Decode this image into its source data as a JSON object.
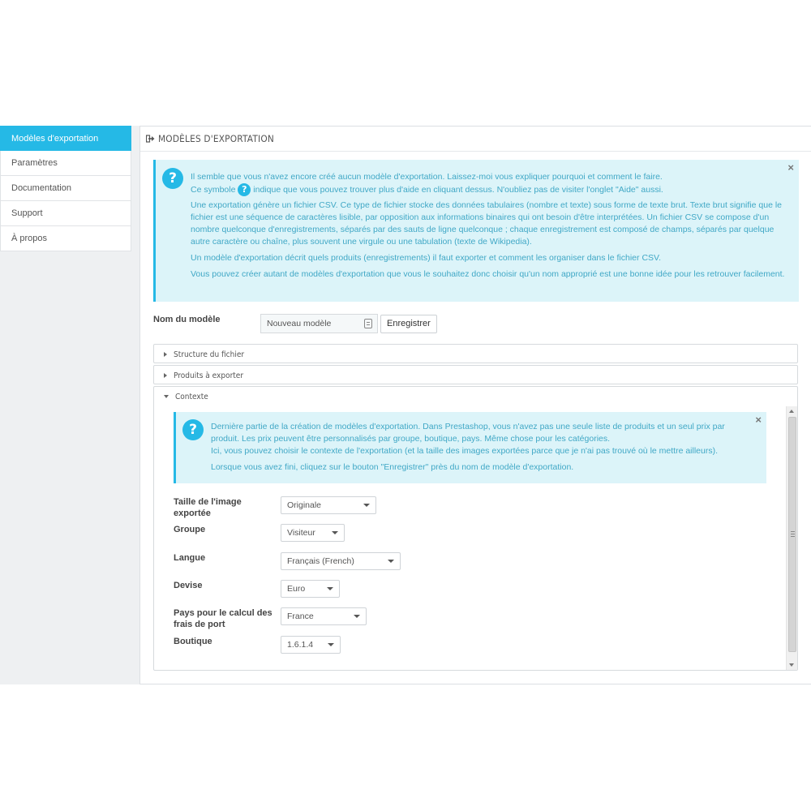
{
  "sidebar": {
    "items": [
      {
        "label": "Modèles d'exportation",
        "active": true
      },
      {
        "label": "Paramètres"
      },
      {
        "label": "Documentation"
      },
      {
        "label": "Support"
      },
      {
        "label": "À propos"
      }
    ]
  },
  "panel": {
    "icon": "sign-out-icon",
    "title": "MODÈLES D'EXPORTATION"
  },
  "intro_alert": {
    "line1": "Il semble que vous n'avez encore créé aucun modèle d'exportation. Laissez-moi vous expliquer pourquoi et comment le faire.",
    "line2_before": "Ce symbole",
    "help_symbol": "?",
    "line2_after": "indique que vous pouvez trouver plus d'aide en cliquant dessus. N'oubliez pas de visiter l'onglet \"Aide\" aussi.",
    "para1": "Une exportation génère un fichier CSV. Ce type de fichier stocke des données tabulaires (nombre et texte) sous forme de texte brut. Texte brut signifie que le fichier est une séquence de caractères lisible, par opposition aux informations binaires qui ont besoin d'être interprétées. Un fichier CSV se compose d'un nombre quelconque d'enregistrements, séparés par des sauts de ligne quelconque ; chaque enregistrement est composé de champs, séparés par quelque autre caractère ou chaîne, plus souvent une virgule ou une tabulation (texte de Wikipedia).",
    "para2": "Un modèle d'exportation décrit quels produits (enregistrements) il faut exporter et comment les organiser dans le fichier CSV.",
    "para3": "Vous pouvez créer autant de modèles d'exportation que vous le souhaitez donc choisir qu'un nom approprié est une bonne idée pour les retrouver facilement.",
    "close": "×"
  },
  "name_row": {
    "label": "Nom du modèle",
    "placeholder": "Nouveau modèle",
    "save_label": "Enregistrer"
  },
  "accordion": [
    {
      "label": "Structure du fichier",
      "expanded": false
    },
    {
      "label": "Produits à exporter",
      "expanded": false
    },
    {
      "label": "Contexte",
      "expanded": true
    }
  ],
  "context_alert": {
    "line1": "Dernière partie de la création de modèles d'exportation. Dans Prestashop, vous n'avez pas une seule liste de produits et un seul prix par produit. Les prix peuvent être personnalisés par groupe, boutique, pays. Même chose pour les catégories.",
    "line2": "Ici, vous pouvez choisir le contexte de l'exportation (et la taille des images exportées parce que je n'ai pas trouvé où le mettre ailleurs).",
    "line3": "Lorsque vous avez fini, cliquez sur le bouton \"Enregistrer\" près du nom de modèle d'exportation.",
    "close": "×"
  },
  "context_form": {
    "image_size": {
      "label": "Taille de l'image exportée",
      "value": "Originale"
    },
    "group": {
      "label": "Groupe",
      "value": "Visiteur"
    },
    "language": {
      "label": "Langue",
      "value": "Français (French)"
    },
    "currency": {
      "label": "Devise",
      "value": "Euro"
    },
    "country": {
      "label": "Pays pour le calcul des frais de port",
      "value": "France"
    },
    "shop": {
      "label": "Boutique",
      "value": "1.6.1.4"
    }
  }
}
